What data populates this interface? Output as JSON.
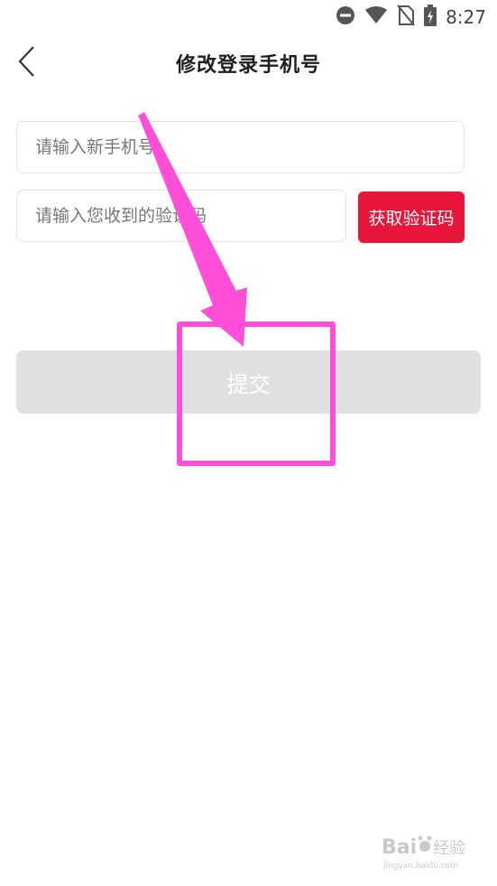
{
  "status_bar": {
    "time": "8:27",
    "icons": [
      "do-not-disturb-icon",
      "wifi-icon",
      "no-sim-icon",
      "battery-charging-icon"
    ]
  },
  "header": {
    "back_icon": "chevron-left-icon",
    "title": "修改登录手机号"
  },
  "form": {
    "phone": {
      "value": "",
      "placeholder": "请输入新手机号"
    },
    "code": {
      "value": "",
      "placeholder": "请输入您收到的验证码"
    },
    "get_code_label": "获取验证码",
    "submit_label": "提交"
  },
  "annotation": {
    "color": "#ff4fd8"
  },
  "watermark": {
    "brand": "Baidu",
    "text": "经验",
    "url": "jingyan.baidu.com"
  },
  "colors": {
    "accent": "#e8163a",
    "submit_disabled": "#e0e0e0",
    "annotation": "#ff4fd8"
  }
}
